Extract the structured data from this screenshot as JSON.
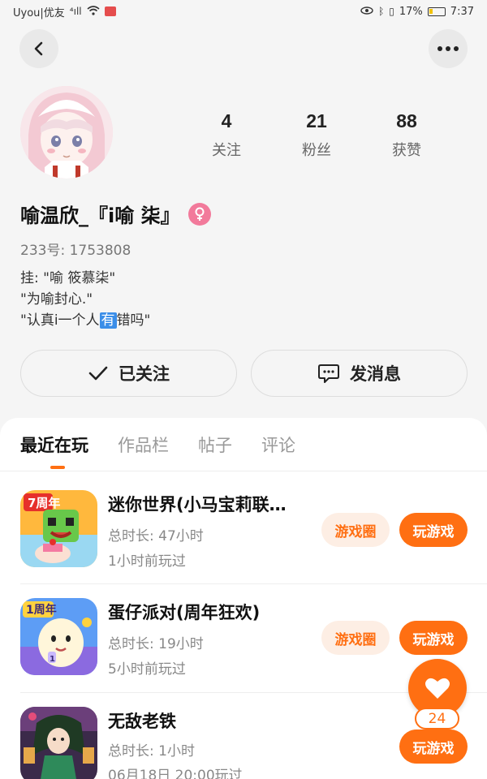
{
  "status_bar": {
    "carrier": "Uyou|优友",
    "signal": "⁴ıll",
    "battery": "17%",
    "time": "7:37"
  },
  "profile": {
    "following_count": "4",
    "following_label": "关注",
    "followers_count": "21",
    "followers_label": "粉丝",
    "likes_count": "88",
    "likes_label": "获赞",
    "username": "喻温欣_『i喻 柒』",
    "uid": "233号: 1753808",
    "bio_line1": "挂: \"喻 筱慕柒\"",
    "bio_line2": "\"为喻封心.\"",
    "bio_line3_a": "\"认真i一个人",
    "bio_line3_badge": "有",
    "bio_line3_b": "错吗\""
  },
  "actions": {
    "follow_label": "已关注",
    "message_label": "发消息"
  },
  "tabs": [
    {
      "label": "最近在玩"
    },
    {
      "label": "作品栏"
    },
    {
      "label": "帖子"
    },
    {
      "label": "评论"
    }
  ],
  "games": [
    {
      "title": "迷你世界(小马宝莉联…",
      "total_time": "总时长: 47小时",
      "last_played": "1小时前玩过",
      "circle_label": "游戏圈",
      "play_label": "玩游戏",
      "icon": "mini-world-icon"
    },
    {
      "title": "蛋仔派对(周年狂欢)",
      "total_time": "总时长: 19小时",
      "last_played": "5小时前玩过",
      "circle_label": "游戏圈",
      "play_label": "玩游戏",
      "icon": "eggy-party-icon"
    },
    {
      "title": "无敌老铁",
      "total_time": "总时长: 1小时",
      "last_played": "06月18日 20:00玩过",
      "play_label": "玩游戏",
      "icon": "wudi-laotie-icon"
    }
  ],
  "like_fab": {
    "count": "24",
    "icon": "heart-icon"
  },
  "colors": {
    "accent": "#ff6f12",
    "accent_light": "#fdeee4",
    "gender": "#f27a9b",
    "background": "#f5f5f5"
  }
}
